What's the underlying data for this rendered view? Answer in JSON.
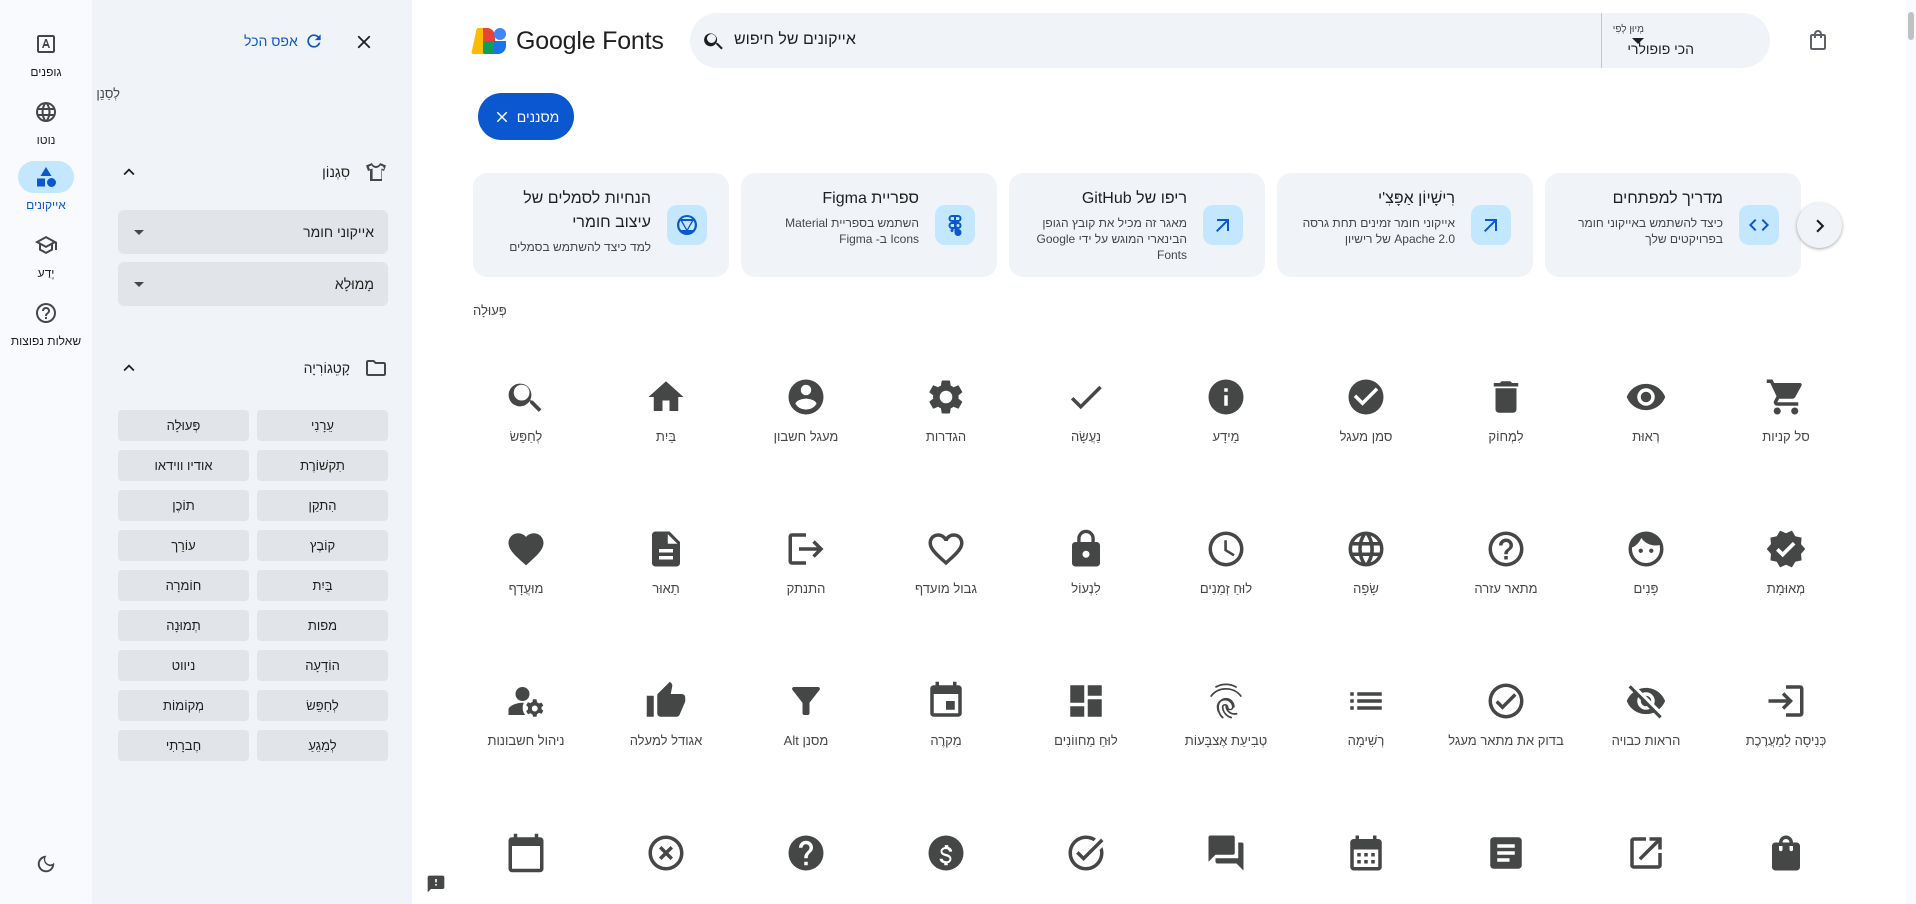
{
  "rail": {
    "items": [
      {
        "label": "גופנים",
        "icon": "fonts-icon"
      },
      {
        "label": "נוטו",
        "icon": "globe-icon"
      },
      {
        "label": "אייקונים",
        "icon": "shapes-icon"
      },
      {
        "label": "יֶדַע",
        "icon": "school-icon"
      },
      {
        "label": "שאלות נפוצות",
        "icon": "help-icon"
      }
    ],
    "active": "אייקונים",
    "theme_icon": "dark-mode-icon"
  },
  "panel": {
    "reset_label": "אפס הכל",
    "clear_label": "לְסַנֵן",
    "style_section": {
      "label": "סִגְנוֹן",
      "icon": "tshirt-icon"
    },
    "style_select": "אייקוני חומר",
    "fill_select": "מָמוּלָא",
    "category_section": {
      "label": "קָטֵגוֹרִיָה",
      "icon": "folder-icon"
    },
    "categories": [
      "עֵרָנִי",
      "פְּעוּלָה",
      "תִקשׁוֹרֶת",
      "אודיו ווידאו",
      "הִתקַן",
      "תוֹכֶן",
      "קוֹבֶץ",
      "עוֹרֵך",
      "בַּיִת",
      "חוֹמרָה",
      "מפות",
      "תְמוּנָה",
      "הוֹדָעָה",
      "ניווט",
      "לְחַפֵּשׂ",
      "מְקוֹמוֹת",
      "לְמַגֵעַ",
      "חֶברָתִי"
    ]
  },
  "header": {
    "brand": "Google Fonts",
    "search_value": "אייקונים של חיפוש",
    "sort_small": "מְיוּן לְפִי",
    "sort_value": "הכי פופולרי"
  },
  "filters_chip": "מסננים",
  "cards": [
    {
      "title": "מדריך למפתחים",
      "desc": "כיצד להשתמש באייקוני חומר בפרויקטים שלך",
      "icon": "code-icon"
    },
    {
      "title": "רִישָׁיוֹן אַפָּצִ'י",
      "desc": "אייקוני חומר זמינים תחת גרסה 2.0 Apache של רישיון",
      "icon": "arrow-outward-icon"
    },
    {
      "title": "ריפו של GitHub",
      "desc": "מאגר זה מכיל את קובץ הגופן הבינארי המוגש על ידי Google Fonts",
      "icon": "arrow-outward-icon"
    },
    {
      "title": "ספריית Figma",
      "desc": "השתמש בספריית Material Icons ב- Figma",
      "icon": "figma-icon"
    },
    {
      "title": "הנחיות לסמלים של עיצוב חומרי",
      "desc": "למד כיצד להשתמש בסמלים",
      "icon": "material-design-icon"
    }
  ],
  "section_label": "פְּעוּלָה",
  "icons": [
    {
      "label": "סל קניות",
      "icon": "shopping-cart-icon"
    },
    {
      "label": "רְאוּת",
      "icon": "visibility-icon"
    },
    {
      "label": "לִמְחוֹק",
      "icon": "delete-icon"
    },
    {
      "label": "סמן מעגל",
      "icon": "check-circle-icon"
    },
    {
      "label": "מֵידָע",
      "icon": "info-icon"
    },
    {
      "label": "נַעֲשָׂה",
      "icon": "done-icon"
    },
    {
      "label": "הגדרות",
      "icon": "settings-icon"
    },
    {
      "label": "מעגל חשבון",
      "icon": "account-circle-icon"
    },
    {
      "label": "בַּיִת",
      "icon": "home-icon"
    },
    {
      "label": "לְחַפֵּשׂ",
      "icon": "search-icon"
    },
    {
      "label": "מְאוּמָת",
      "icon": "verified-icon"
    },
    {
      "label": "פָּנִים",
      "icon": "face-icon"
    },
    {
      "label": "מתאר עזרה",
      "icon": "help-outline-icon"
    },
    {
      "label": "שָׂפָה",
      "icon": "language-icon"
    },
    {
      "label": "לוּחַ זְמַנִים",
      "icon": "schedule-icon"
    },
    {
      "label": "לִנְעוֹל",
      "icon": "lock-icon"
    },
    {
      "label": "גבול מועדף",
      "icon": "favorite-border-icon"
    },
    {
      "label": "התנתק",
      "icon": "logout-icon"
    },
    {
      "label": "תֵאוּר",
      "icon": "description-icon"
    },
    {
      "label": "מוּעֲדָף",
      "icon": "favorite-icon"
    },
    {
      "label": "כְּנִיסָה לַמַעֲרֶכֶת",
      "icon": "login-icon"
    },
    {
      "label": "הראות כבויה",
      "icon": "visibility-off-icon"
    },
    {
      "label": "בדוק את מתאר מעגל",
      "icon": "check-circle-outline-icon"
    },
    {
      "label": "רְשִׁימָה",
      "icon": "list-icon"
    },
    {
      "label": "טְבִיעַת אֶצבָּעוֹת",
      "icon": "fingerprint-icon"
    },
    {
      "label": "לוּחַ מַחווֹנִים",
      "icon": "dashboard-icon"
    },
    {
      "label": "מִקרֶה",
      "icon": "event-icon"
    },
    {
      "label": "מסנן Alt",
      "icon": "filter-alt-icon"
    },
    {
      "label": "אגודל למעלה",
      "icon": "thumb-up-icon"
    },
    {
      "label": "ניהול חשבונות",
      "icon": "manage-accounts-icon"
    },
    {
      "label": "",
      "icon": "shopping-bag-icon"
    },
    {
      "label": "",
      "icon": "open-in-new-icon"
    },
    {
      "label": "",
      "icon": "article-icon"
    },
    {
      "label": "",
      "icon": "calendar-month-icon"
    },
    {
      "label": "",
      "icon": "question-answer-icon"
    },
    {
      "label": "",
      "icon": "task-alt-icon"
    },
    {
      "label": "",
      "icon": "paid-icon"
    },
    {
      "label": "",
      "icon": "help-icon"
    },
    {
      "label": "",
      "icon": "highlight-off-icon"
    },
    {
      "label": "",
      "icon": "calendar-today-icon"
    }
  ],
  "colors": {
    "accent": "#0b57d0",
    "accent_light": "#c2e7ff",
    "panel_bg": "#f0f4f9",
    "icon_gray": "#444746"
  }
}
